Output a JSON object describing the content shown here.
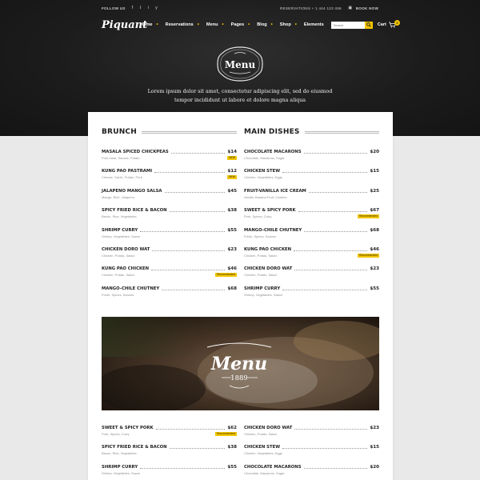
{
  "topbar": {
    "follow_label": "FOLLOW US",
    "socials": [
      "f",
      "t",
      "i",
      "y"
    ],
    "social_icons": [
      "facebook-icon",
      "twitter-icon",
      "instagram-icon",
      "youtube-icon"
    ],
    "reservations": "RESERVATIONS + 1 444 123 456",
    "book_now": "BOOK NOW"
  },
  "brand": {
    "logo": "Piquant"
  },
  "nav": {
    "items": [
      "Home",
      "Reservations",
      "Menu",
      "Pages",
      "Blog",
      "Shop",
      "Elements"
    ]
  },
  "search": {
    "placeholder": "Search"
  },
  "cart": {
    "label": "Cart",
    "count": "0"
  },
  "hero": {
    "emblem_text": "Menu",
    "line1": "Lorem ipsum dolor sit amet, consectetur adipiscing elit, sed do eiusmod",
    "line2": "tempor incididunt ut labore et dolore magna aliqua"
  },
  "brunch": {
    "title": "BRUNCH",
    "items": [
      {
        "name": "MASALA SPICED CHICKPEAS",
        "price": "$14",
        "desc": "Pork meat, Sauces, Potato",
        "tag": "NEW"
      },
      {
        "name": "KUNG PAO PASTRAMI",
        "price": "$12",
        "desc": "Cheese, Garlic, Potato, Pork",
        "tag": "NEW"
      },
      {
        "name": "JALAPENO MANGO SALSA",
        "price": "$45",
        "desc": "Mango, Rice, Jalapeno",
        "tag": ""
      },
      {
        "name": "SPICY FRIED RICE & BACON",
        "price": "$38",
        "desc": "Bacon, Rice, Vegetables",
        "tag": ""
      },
      {
        "name": "SHRIMP CURRY",
        "price": "$55",
        "desc": "Shrimp, Vegetables, Sauce",
        "tag": ""
      },
      {
        "name": "CHICKEN DORO WAT",
        "price": "$23",
        "desc": "Chicken, Potato, Salad",
        "tag": ""
      },
      {
        "name": "KUNG PAO CHICKEN",
        "price": "$46",
        "desc": "Chicken, Potato, Salad",
        "tag": "Recommended"
      },
      {
        "name": "MANGO-CHILE CHUTNEY",
        "price": "$68",
        "desc": "Fresh, Spices, Sauces",
        "tag": ""
      }
    ]
  },
  "main": {
    "title": "MAIN DISHES",
    "items": [
      {
        "name": "CHOCOLATE MACARONS",
        "price": "$20",
        "desc": "Chocolate, Macarons, Sugar",
        "tag": ""
      },
      {
        "name": "CHICKEN STEW",
        "price": "$15",
        "desc": "Chicken, Vegetables, Eggs",
        "tag": ""
      },
      {
        "name": "FRUIT-VANILLA ICE CREAM",
        "price": "$25",
        "desc": "Vanilla, Banana Fruit, Cookies",
        "tag": ""
      },
      {
        "name": "SWEET & SPICY PORK",
        "price": "$67",
        "desc": "Pork, Spices, Curry",
        "tag": "Recommended"
      },
      {
        "name": "MANGO-CHILE CHUTNEY",
        "price": "$68",
        "desc": "Fresh, Spices, Sauces",
        "tag": ""
      },
      {
        "name": "KUNG PAO CHICKEN",
        "price": "$46",
        "desc": "Chicken, Potato, Salad",
        "tag": "Recommended"
      },
      {
        "name": "CHICKEN DORO WAT",
        "price": "$23",
        "desc": "Chicken, Potato, Salad",
        "tag": ""
      },
      {
        "name": "SHRIMP CURRY",
        "price": "$55",
        "desc": "Shrimp, Vegetables, Sauce",
        "tag": ""
      }
    ]
  },
  "photo": {
    "title": "Menu",
    "year": "1889"
  },
  "more_left": {
    "items": [
      {
        "name": "SWEET & SPICY PORK",
        "price": "$62",
        "desc": "Pork, Spices, Curry",
        "tag": "Recommended"
      },
      {
        "name": "SPICY FRIED RICE & BACON",
        "price": "$38",
        "desc": "Bacon, Rice, Vegetables",
        "tag": ""
      },
      {
        "name": "SHRIMP CURRY",
        "price": "$55",
        "desc": "Shrimp, Vegetables, Sauce",
        "tag": ""
      }
    ]
  },
  "more_right": {
    "items": [
      {
        "name": "CHICKEN DORO WAT",
        "price": "$23",
        "desc": "Chicken, Potato, Salad",
        "tag": ""
      },
      {
        "name": "CHICKEN STEW",
        "price": "$15",
        "desc": "Chicken, Vegetables, Eggs",
        "tag": ""
      },
      {
        "name": "CHOCOLATE MACARONS",
        "price": "$20",
        "desc": "Chocolate, Macarons, Sugar",
        "tag": ""
      }
    ]
  },
  "colors": {
    "accent": "#f2c500",
    "dark": "#1c1c1c",
    "text": "#1f1f1f"
  }
}
